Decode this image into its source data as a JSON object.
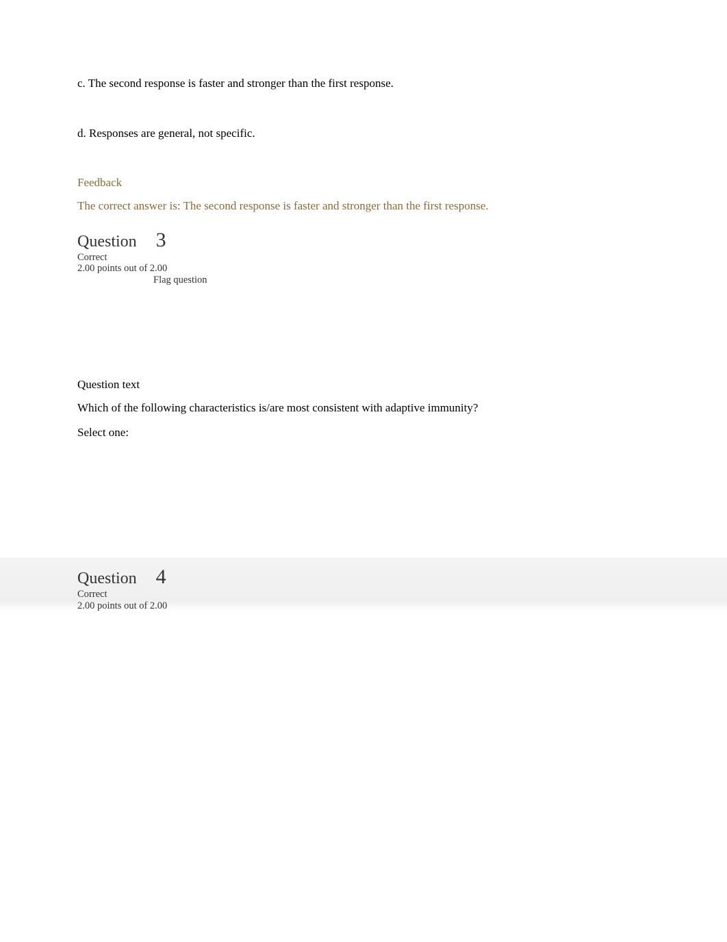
{
  "previousQuestion": {
    "options": {
      "c": {
        "letter": "c.",
        "text": "The second response is faster and stronger than the first response."
      },
      "d": {
        "letter": "d.",
        "text": "Responses are general, not specific."
      }
    },
    "feedback": {
      "heading": "Feedback",
      "answer": "The correct answer is: The second response is faster and stronger than the first response."
    }
  },
  "question3": {
    "label": "Question",
    "number": "3",
    "status": "Correct",
    "points": "2.00 points out of 2.00",
    "flag": "Flag question",
    "textHeading": "Question text",
    "prompt": "Which of the following characteristics is/are most consistent with adaptive immunity?",
    "selectOne": "Select one:"
  },
  "question4": {
    "label": "Question",
    "number": "4",
    "status": "Correct",
    "points": "2.00 points out of 2.00"
  }
}
